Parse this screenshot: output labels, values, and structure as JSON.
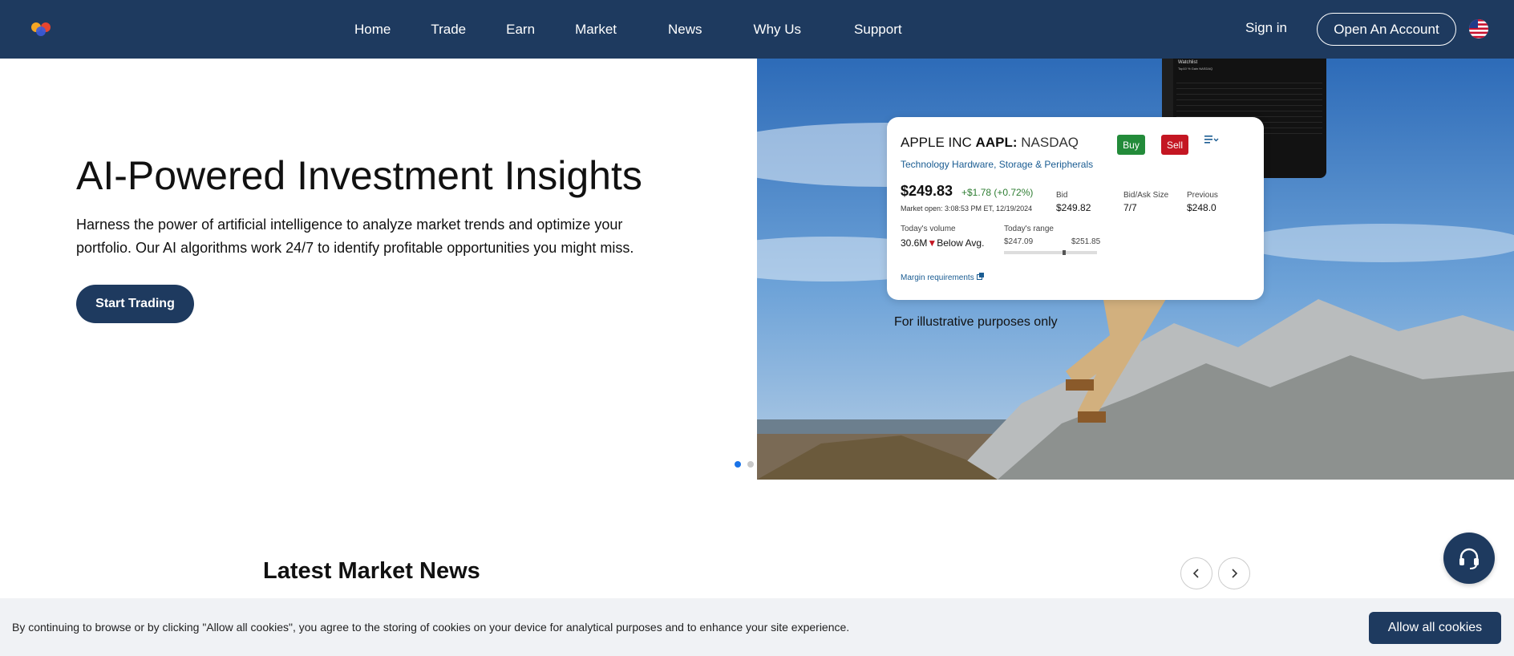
{
  "nav": {
    "logo_icon": "brand-logo-icon",
    "links": [
      "Home",
      "Trade",
      "Earn",
      "Market",
      "News",
      "Why Us",
      "Support"
    ],
    "sign_in": "Sign in",
    "open_account": "Open An Account",
    "flag_icon": "us-flag-icon"
  },
  "hero": {
    "title": "AI-Powered Investment Insights",
    "description": "Harness the power of artificial intelligence to analyze market trends and optimize your portfolio. Our AI algorithms work 24/7 to identify profitable opportunities you might miss.",
    "cta": "Start Trading",
    "slides_total": 2,
    "slide_active": 1
  },
  "card": {
    "company": "APPLE INC",
    "ticker": "AAPL:",
    "exchange": "NASDAQ",
    "buy": "Buy",
    "sell": "Sell",
    "sector": "Technology Hardware, Storage & Peripherals",
    "price": "$249.83",
    "change": "+$1.78  (+0.72%)",
    "market_open": "Market open: 3:08:53 PM ET, 12/19/2024",
    "bid_label": "Bid",
    "bid_value": "$249.82",
    "bidask_label": "Bid/Ask Size",
    "bidask_value": "7/7",
    "previous_label": "Previous",
    "previous_value": "$248.0",
    "volume_label": "Today's volume",
    "volume_value": "30.6M",
    "volume_note": "Below Avg.",
    "range_label": "Today's range",
    "range_low": "$247.09",
    "range_high": "$251.85",
    "range_position": 0.65,
    "margin": "Margin requirements"
  },
  "watchlist": {
    "title": "Watchlist",
    "subtitle": "Top10 % Gain NASDAQ"
  },
  "illustrative": "For illustrative purposes only",
  "news": {
    "title": "Latest Market News"
  },
  "cookie": {
    "text": "By continuing to browse or by clicking \"Allow all cookies\", you agree to the storing of cookies on your device for analytical purposes and to enhance your site experience.",
    "button": "Allow all cookies"
  },
  "colors": {
    "nav_bg": "#1e3a5f",
    "buy": "#238b3a",
    "sell": "#c41622",
    "accent_dot": "#1a73e8"
  }
}
